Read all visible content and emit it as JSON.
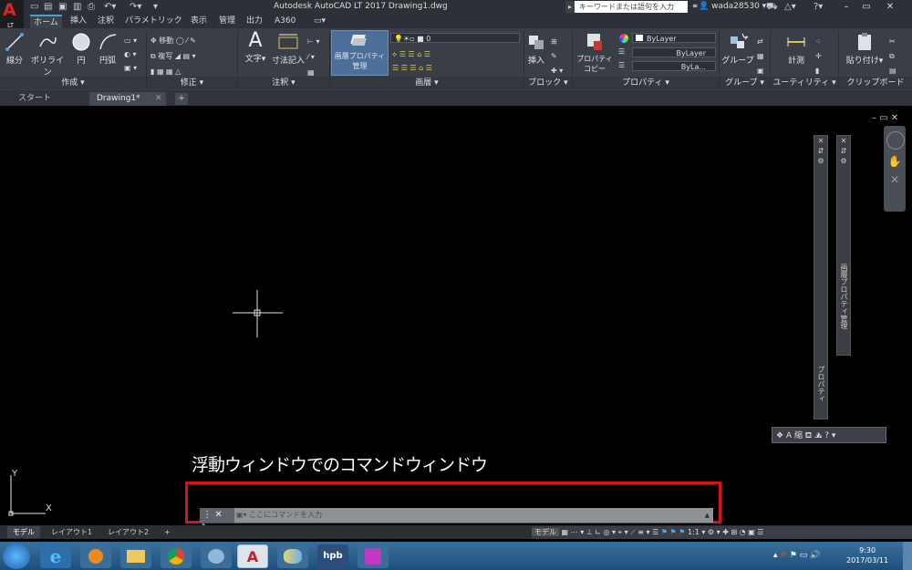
{
  "window": {
    "title": "Autodesk AutoCAD LT 2017     Drawing1.dwg",
    "logo_letter": "A",
    "logo_sub": "LT",
    "search_placeholder": "キーワードまたは語句を入力",
    "user": "wada28530"
  },
  "ribbon_tabs": [
    "ホーム",
    "挿入",
    "注釈",
    "パラメトリック",
    "表示",
    "管理",
    "出力",
    "A360"
  ],
  "panels": {
    "draw": {
      "title": "作成 ▾",
      "line": "線分",
      "polyline": "ポリライン",
      "circle": "円",
      "arc": "円弧"
    },
    "modify": {
      "title": "修正 ▾",
      "move": "移動",
      "copy": "複写"
    },
    "annotation": {
      "title": "注釈 ▾",
      "text": "文字",
      "dim": "寸法記入"
    },
    "layers": {
      "title": "画層 ▾",
      "layer_props": "画層プロパティ\n管理",
      "layer_name": "0"
    },
    "block": {
      "title": "ブロック ▾",
      "insert": "挿入"
    },
    "properties": {
      "title": "プロパティ ▾",
      "match": "プロパティ\nコピー",
      "color": "ByLayer",
      "linetype": "ByLayer",
      "lineweight": "ByLa..."
    },
    "groups": {
      "title": "グループ ▾",
      "group": "グループ"
    },
    "utilities": {
      "title": "ユーティリティ ▾",
      "measure": "計測"
    },
    "clipboard": {
      "title": "クリップボード",
      "paste": "貼り付け"
    }
  },
  "file_tabs": [
    "スタート",
    "Drawing1*"
  ],
  "palettes": {
    "properties": "プロパティ",
    "layer_manager": "画層プロパティ管理"
  },
  "annotation_text": "浮動ウィンドウでのコマンドウィンドウ",
  "command": {
    "placeholder": "ここにコマンドを入力"
  },
  "layout_tabs": [
    "モデル",
    "レイアウト1",
    "レイアウト2"
  ],
  "status": {
    "model": "モデル",
    "scale": "1:1"
  },
  "ucs": {
    "x": "X",
    "y": "Y"
  },
  "clock": {
    "time": "9:30",
    "date": "2017/03/11"
  },
  "colors": {
    "ribbon": "#3a3f47",
    "annotation_box": "#d4141a",
    "taskbar": "#2a5f8f"
  }
}
